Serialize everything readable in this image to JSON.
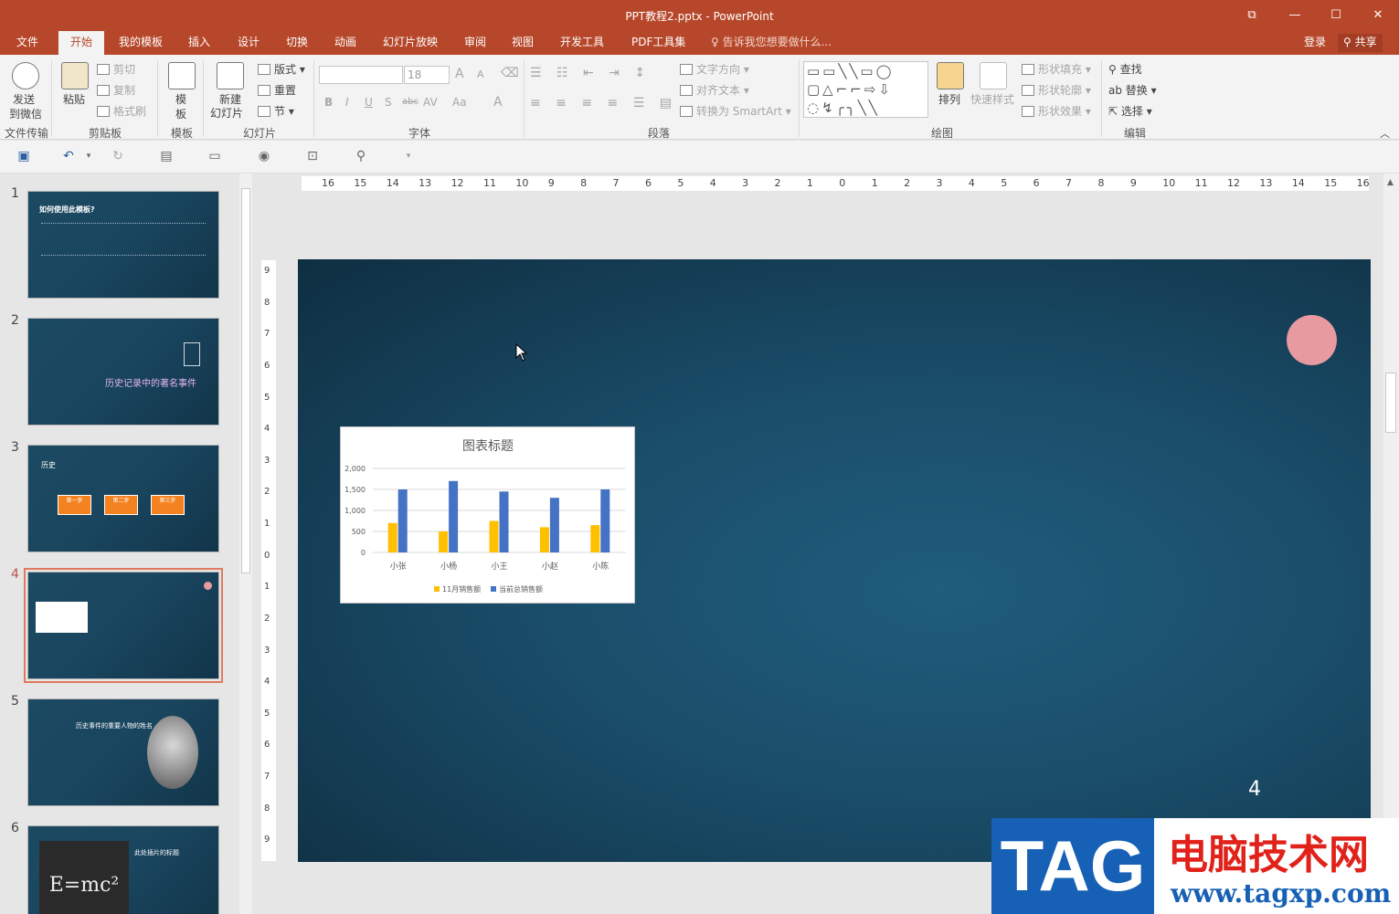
{
  "window": {
    "title": "PPT教程2.pptx - PowerPoint",
    "controls": {
      "restore_ribbon": "⧉",
      "minimize": "—",
      "maximize": "☐",
      "close": "✕"
    }
  },
  "tabs": [
    "文件",
    "开始",
    "我的模板",
    "插入",
    "设计",
    "切换",
    "动画",
    "幻灯片放映",
    "审阅",
    "视图",
    "开发工具",
    "PDF工具集"
  ],
  "active_tab": "开始",
  "tell_me": "告诉我您想要做什么...",
  "account": {
    "login": "登录",
    "share": "共享"
  },
  "ribbon": {
    "file_transfer": {
      "send": "发送",
      "send2": "到微信",
      "group": "文件传输"
    },
    "clipboard": {
      "paste": "粘贴",
      "cut": "剪切",
      "copy": "复制",
      "format_painter": "格式刷",
      "group": "剪贴板"
    },
    "template": {
      "label1": "模",
      "label2": "板",
      "group": "模板"
    },
    "slides": {
      "new1": "新建",
      "new2": "幻灯片",
      "layout": "版式",
      "reset": "重置",
      "section": "节",
      "group": "幻灯片"
    },
    "font": {
      "font_size": "18",
      "group": "字体",
      "bold": "B",
      "italic": "I",
      "underline": "U",
      "shadow": "S",
      "strike": "abc",
      "spacing": "AV",
      "case": "Aa",
      "color": "A",
      "grow": "A",
      "shrink": "A"
    },
    "paragraph": {
      "text_direction": "文字方向",
      "align_text": "对齐文本",
      "smartart": "转换为 SmartArt",
      "group": "段落"
    },
    "drawing": {
      "arrange": "排列",
      "quick_styles": "快速样式",
      "shape_fill": "形状填充",
      "shape_outline": "形状轮廓",
      "shape_effects": "形状效果",
      "group": "绘图"
    },
    "editing": {
      "find": "查找",
      "replace": "替换",
      "select": "选择",
      "group": "编辑"
    }
  },
  "rulers": {
    "horizontal": [
      "16",
      "15",
      "14",
      "13",
      "12",
      "11",
      "10",
      "9",
      "8",
      "7",
      "6",
      "5",
      "4",
      "3",
      "2",
      "1",
      "0",
      "1",
      "2",
      "3",
      "4",
      "5",
      "6",
      "7",
      "8",
      "9",
      "10",
      "11",
      "12",
      "13",
      "14",
      "15",
      "16"
    ],
    "vertical": [
      "9",
      "8",
      "7",
      "6",
      "5",
      "4",
      "3",
      "2",
      "1",
      "0",
      "1",
      "2",
      "3",
      "4",
      "5",
      "6",
      "7",
      "8",
      "9"
    ]
  },
  "thumbnails": [
    {
      "num": "1",
      "title": "如何使用此模板?"
    },
    {
      "num": "2",
      "title": "历史记录中的著名事件"
    },
    {
      "num": "3",
      "title": "历史",
      "steps": [
        "第一步",
        "第二步",
        "第三步"
      ]
    },
    {
      "num": "4",
      "title": ""
    },
    {
      "num": "5",
      "title": "历史事件的重要人物的姓名"
    },
    {
      "num": "6",
      "title": "此处插片的标题",
      "formula": "E=mc²"
    }
  ],
  "active_slide": "4",
  "slide": {
    "page_number": "4"
  },
  "chart_data": {
    "type": "bar",
    "title": "图表标题",
    "categories": [
      "小张",
      "小杨",
      "小王",
      "小赵",
      "小陈"
    ],
    "series": [
      {
        "name": "11月销售额",
        "color": "#ffc000",
        "values": [
          700,
          500,
          750,
          600,
          650
        ]
      },
      {
        "name": "当前总销售额",
        "color": "#4472c4",
        "values": [
          1500,
          1700,
          1450,
          1300,
          1500
        ]
      }
    ],
    "ylim": [
      0,
      2000
    ],
    "yticks": [
      "0",
      "500",
      "1,000",
      "1,500",
      "2,000"
    ],
    "grid": true,
    "legend": "bottom"
  },
  "watermark": {
    "tag": "TAG",
    "site_name": "电脑技术网",
    "url": "www.tagxp.com"
  }
}
